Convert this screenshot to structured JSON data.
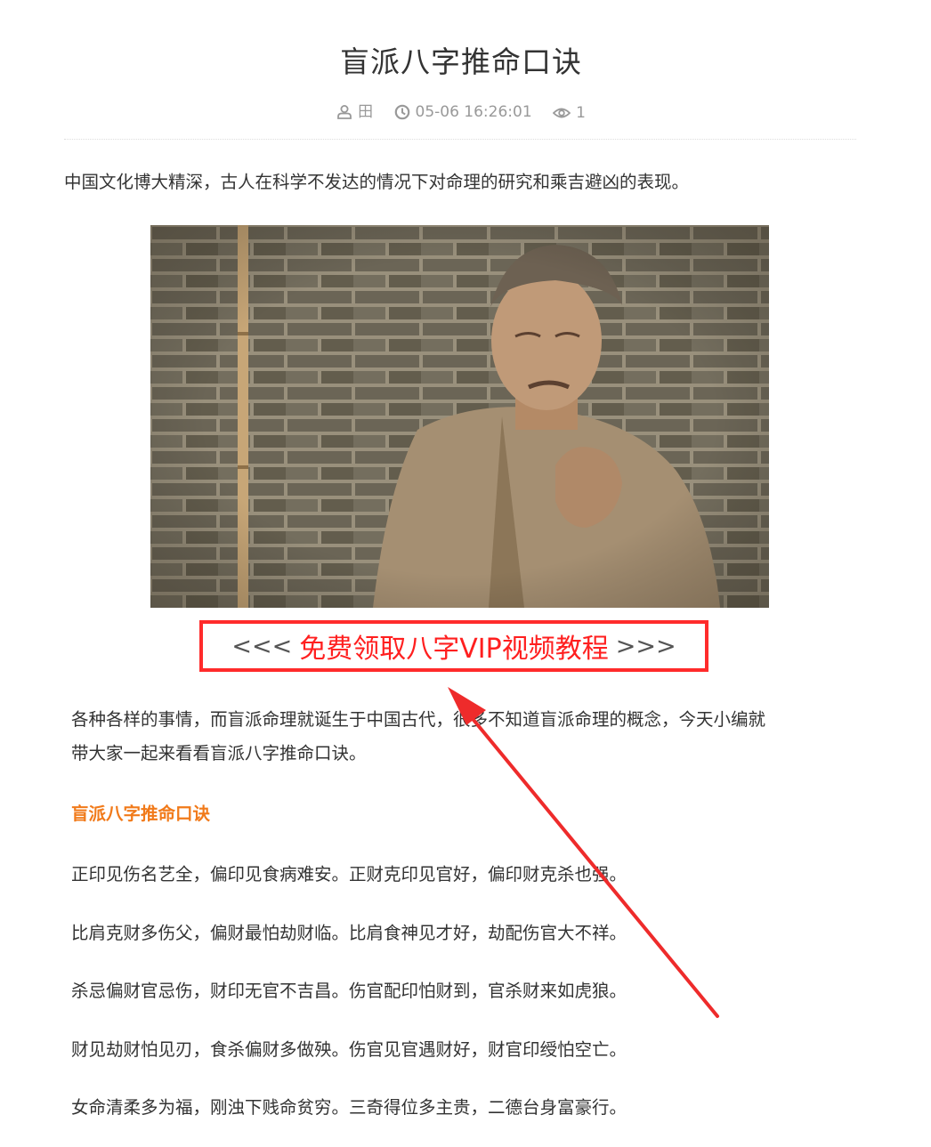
{
  "article": {
    "title": "盲派八字推命口诀",
    "meta": {
      "author": "田",
      "time": "05-06 16:26:01",
      "views": "1"
    },
    "intro": "中国文化博大精深，古人在科学不发达的情况下对命理的研究和乘吉避凶的表现。",
    "promo": {
      "left_arrows": "<<<",
      "link_text": "免费领取八字VIP视频教程",
      "right_arrows": ">>>"
    },
    "lead_lines": [
      "各种各样的事情，而盲派命理就诞生于中国古代，很多不知道盲派命理的概念，今天小编就",
      "带大家一起来看看盲派八字推命口诀。"
    ],
    "subheading": "盲派八字推命口诀",
    "verses": [
      "正印见伤名艺全，偏印见食病难安。正财克印见官好，偏印财克杀也强。",
      "比肩克财多伤父，偏财最怕劫财临。比肩食神见才好，劫配伤官大不祥。",
      "杀忌偏财官忌伤，财印无官不吉昌。伤官配印怕财到，官杀财来如虎狼。",
      "财见劫财怕见刃，食杀偏财多做殃。伤官见官遇财好，财官印绶怕空亡。",
      "女命清柔多为福，刚浊下贱命贫穷。三奇得位多主贵，二德台身富豪行。"
    ]
  },
  "icons": {
    "author": "user-icon",
    "time": "clock-icon",
    "views": "eye-icon"
  },
  "colors": {
    "title": "#333333",
    "meta": "#999999",
    "promo_border": "#ff2b2b",
    "promo_text": "#ff1f1f",
    "subheading": "#f17a1a",
    "annotation_arrow": "#ee2b2b"
  }
}
